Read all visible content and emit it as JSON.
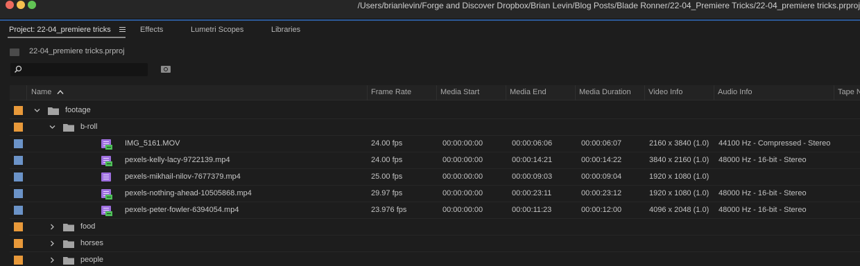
{
  "window": {
    "title": "/Users/brianlevin/Forge and Discover Dropbox/Brian Levin/Blog Posts/Blade Ronner/22-04_Premiere Tricks/22-04_premiere tricks.prproj"
  },
  "tabs": [
    {
      "label": "Project: 22-04_premiere tricks",
      "active": true
    },
    {
      "label": "Effects"
    },
    {
      "label": "Lumetri Scopes"
    },
    {
      "label": "Libraries"
    }
  ],
  "project": {
    "filename": "22-04_premiere tricks.prproj"
  },
  "search": {
    "value": "",
    "placeholder": ""
  },
  "columns": [
    "Name",
    "Frame Rate",
    "Media Start",
    "Media End",
    "Media Duration",
    "Video Info",
    "Audio Info",
    "Tape Name"
  ],
  "colors": {
    "accent": "#2d5b9a",
    "folder_label": "#e8993a",
    "clip_label": "#6b93c8",
    "clip_icon": "#9f6fe0",
    "audio_strip": "#4fbf5a"
  },
  "rows": [
    {
      "name": "footage",
      "type": "folder",
      "level": 0,
      "expanded": true,
      "label_color": "#e8993a",
      "icon": "folder-icon",
      "frame_rate": "",
      "media_start": "",
      "media_end": "",
      "media_duration": "",
      "video_info": "",
      "audio_info": ""
    },
    {
      "name": "b-roll",
      "type": "folder",
      "level": 1,
      "expanded": true,
      "label_color": "#e8993a",
      "icon": "folder-icon",
      "frame_rate": "",
      "media_start": "",
      "media_end": "",
      "media_duration": "",
      "video_info": "",
      "audio_info": ""
    },
    {
      "name": "IMG_5161.MOV",
      "type": "clip",
      "level": 2,
      "has_audio": true,
      "label_color": "#6b93c8",
      "icon": "video-clip-icon",
      "frame_rate": "24.00 fps",
      "media_start": "00:00:00:00",
      "media_end": "00:00:06:06",
      "media_duration": "00:00:06:07",
      "video_info": "2160 x 3840 (1.0)",
      "audio_info": "44100 Hz - Compressed - Stereo"
    },
    {
      "name": "pexels-kelly-lacy-9722139.mp4",
      "type": "clip",
      "level": 2,
      "has_audio": true,
      "label_color": "#6b93c8",
      "icon": "video-clip-icon",
      "frame_rate": "24.00 fps",
      "media_start": "00:00:00:00",
      "media_end": "00:00:14:21",
      "media_duration": "00:00:14:22",
      "video_info": "3840 x 2160 (1.0)",
      "audio_info": "48000 Hz - 16-bit - Stereo"
    },
    {
      "name": "pexels-mikhail-nilov-7677379.mp4",
      "type": "clip",
      "level": 2,
      "has_audio": false,
      "label_color": "#6b93c8",
      "icon": "video-clip-icon",
      "frame_rate": "25.00 fps",
      "media_start": "00:00:00:00",
      "media_end": "00:00:09:03",
      "media_duration": "00:00:09:04",
      "video_info": "1920 x 1080 (1.0)",
      "audio_info": ""
    },
    {
      "name": "pexels-nothing-ahead-10505868.mp4",
      "type": "clip",
      "level": 2,
      "has_audio": true,
      "label_color": "#6b93c8",
      "icon": "video-clip-icon",
      "frame_rate": "29.97 fps",
      "media_start": "00:00:00:00",
      "media_end": "00:00:23:11",
      "media_duration": "00:00:23:12",
      "video_info": "1920 x 1080 (1.0)",
      "audio_info": "48000 Hz - 16-bit - Stereo"
    },
    {
      "name": "pexels-peter-fowler-6394054.mp4",
      "type": "clip",
      "level": 2,
      "has_audio": true,
      "label_color": "#6b93c8",
      "icon": "video-clip-icon",
      "frame_rate": "23.976 fps",
      "media_start": "00:00:00:00",
      "media_end": "00:00:11:23",
      "media_duration": "00:00:12:00",
      "video_info": "4096 x 2048 (1.0)",
      "audio_info": "48000 Hz - 16-bit - Stereo"
    },
    {
      "name": "food",
      "type": "folder",
      "level": 1,
      "expanded": false,
      "label_color": "#e8993a",
      "icon": "folder-icon",
      "frame_rate": "",
      "media_start": "",
      "media_end": "",
      "media_duration": "",
      "video_info": "",
      "audio_info": ""
    },
    {
      "name": "horses",
      "type": "folder",
      "level": 1,
      "expanded": false,
      "label_color": "#e8993a",
      "icon": "folder-icon",
      "frame_rate": "",
      "media_start": "",
      "media_end": "",
      "media_duration": "",
      "video_info": "",
      "audio_info": ""
    },
    {
      "name": "people",
      "type": "folder",
      "level": 1,
      "expanded": false,
      "label_color": "#e8993a",
      "icon": "folder-icon",
      "frame_rate": "",
      "media_start": "",
      "media_end": "",
      "media_duration": "",
      "video_info": "",
      "audio_info": ""
    }
  ]
}
